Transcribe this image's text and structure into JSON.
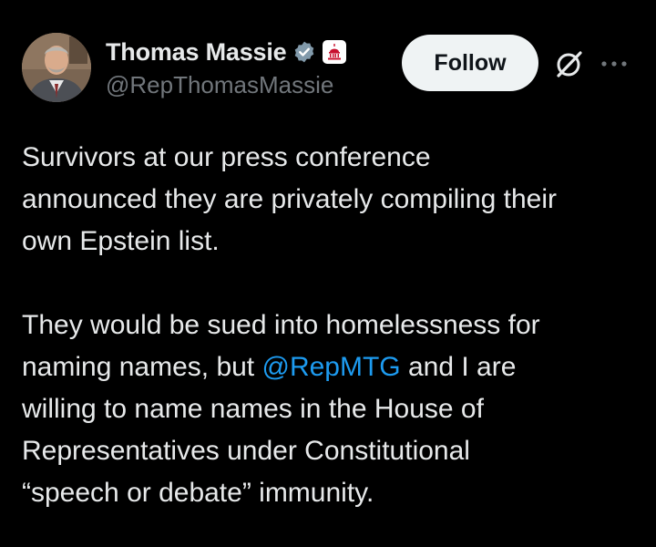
{
  "header": {
    "display_name": "Thomas Massie",
    "handle": "@RepThomasMassie",
    "follow_label": "Follow",
    "verified_icon": "verified-badge-icon",
    "affiliation_icon": "us-capitol-affiliation-icon",
    "grok_icon": "grok-icon",
    "more_icon": "more-options-icon"
  },
  "tweet": {
    "paragraph_1": {
      "line_1": "Survivors at our press conference",
      "line_2": "announced they are privately compiling their",
      "line_3": "own Epstein list."
    },
    "paragraph_2": {
      "line_1": "They would be sued into homelessness for",
      "line_2_before": "naming names, but ",
      "line_2_mention": "@RepMTG",
      "line_2_after": " and I are",
      "line_3": "willing to name names in the House of",
      "line_4": "Representatives under Constitutional",
      "line_5": "“speech or debate” immunity."
    }
  },
  "colors": {
    "background": "#000000",
    "text": "#e7e9ea",
    "secondary": "#71767b",
    "mention": "#1d9bf0",
    "verified": "#829aab",
    "affiliation": "#c8102e",
    "follow_bg": "#eff3f4"
  }
}
